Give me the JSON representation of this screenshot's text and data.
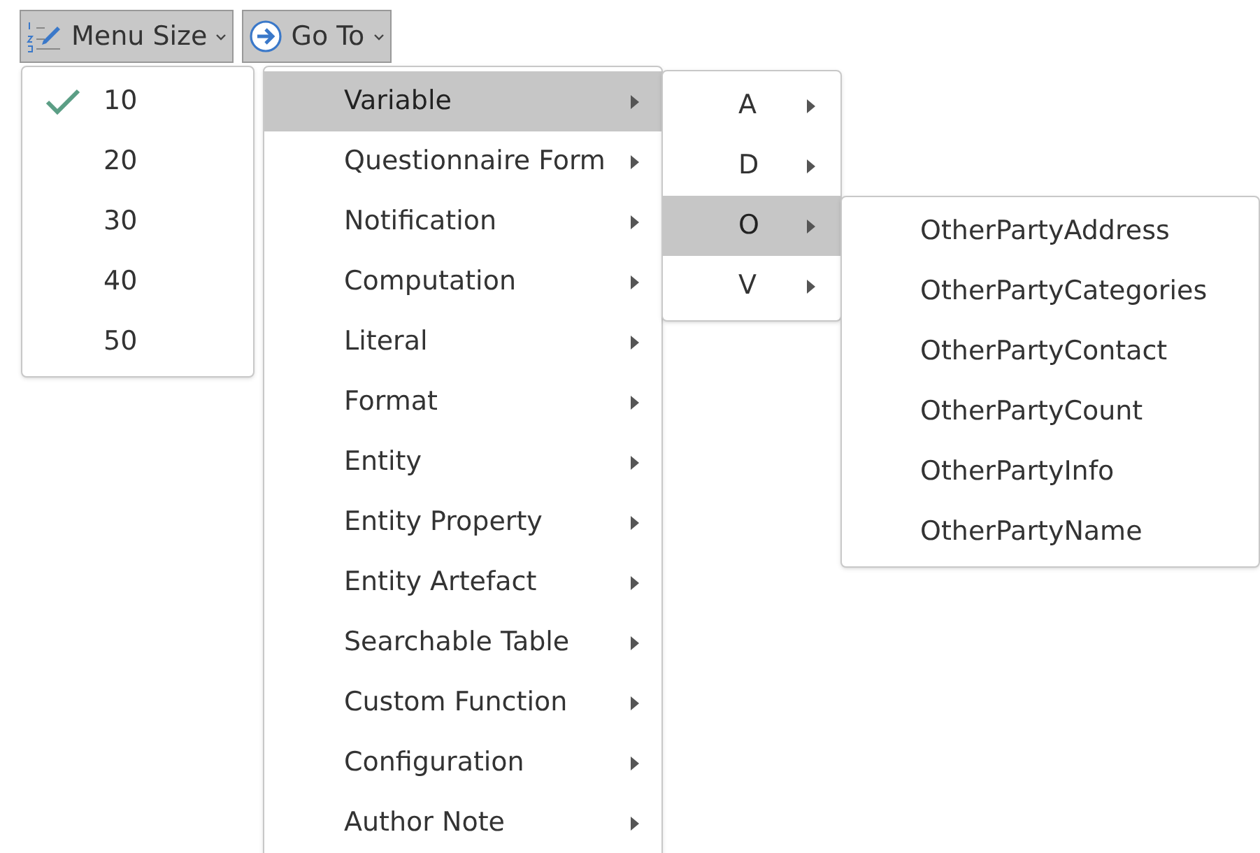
{
  "toolbar": [
    {
      "label": "Menu Size",
      "kind": "list",
      "expanded": true
    },
    {
      "label": "Go To",
      "kind": "arrow",
      "expanded": true
    }
  ],
  "menu_size": [
    {
      "label": "10",
      "checked": true
    },
    {
      "label": "20",
      "checked": false
    },
    {
      "label": "30",
      "checked": false
    },
    {
      "label": "40",
      "checked": false
    },
    {
      "label": "50",
      "checked": false
    }
  ],
  "go_to": [
    {
      "label": "Variable",
      "selected": true
    },
    {
      "label": "Questionnaire Form",
      "selected": false
    },
    {
      "label": "Notification",
      "selected": false
    },
    {
      "label": "Computation",
      "selected": false
    },
    {
      "label": "Literal",
      "selected": false
    },
    {
      "label": "Format",
      "selected": false
    },
    {
      "label": "Entity",
      "selected": false
    },
    {
      "label": "Entity Property",
      "selected": false
    },
    {
      "label": "Entity Artefact",
      "selected": false
    },
    {
      "label": "Searchable Table",
      "selected": false
    },
    {
      "label": "Custom Function",
      "selected": false
    },
    {
      "label": "Configuration",
      "selected": false
    },
    {
      "label": "Author Note",
      "selected": false
    }
  ],
  "letters": [
    {
      "label": "A",
      "selected": false
    },
    {
      "label": "D",
      "selected": false
    },
    {
      "label": "O",
      "selected": true
    },
    {
      "label": "V",
      "selected": false
    }
  ],
  "variables": [
    {
      "label": "OtherPartyAddress",
      "selected": false
    },
    {
      "label": "OtherPartyCategories",
      "selected": false
    },
    {
      "label": "OtherPartyContact",
      "selected": false
    },
    {
      "label": "OtherPartyCount",
      "selected": false
    },
    {
      "label": "OtherPartyInfo",
      "selected": false
    },
    {
      "label": "OtherPartyName",
      "selected": false
    }
  ]
}
